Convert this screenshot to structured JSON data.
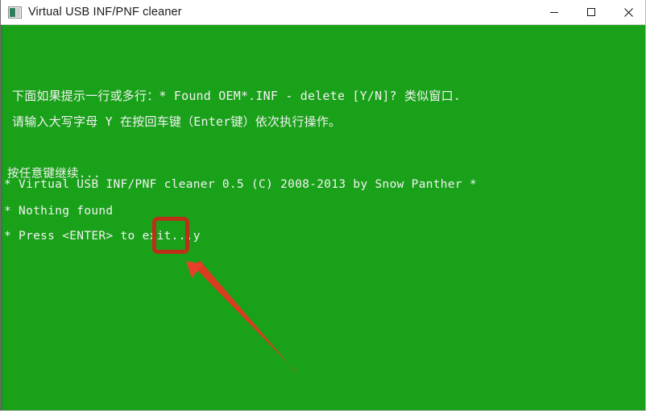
{
  "window": {
    "title": "Virtual USB INF/PNF cleaner",
    "icon": "console-window-icon",
    "controls": {
      "minimize": "minimize-icon",
      "maximize": "maximize-icon",
      "close": "close-icon"
    }
  },
  "console": {
    "background_color": "#1AA11A",
    "text_color": "#f2f2f2",
    "instructions": [
      "下面如果提示一行或多行：* Found OEM*.INF - delete [Y/N]? 类似窗口.",
      "请输入大写字母 Y 在按回车键（Enter键）依次执行操作。"
    ],
    "output_lines": [
      "按任意键继续...",
      "* Virtual USB INF/PNF cleaner 0.5 (C) 2008-2013 by Snow Panther *",
      "* Nothing found",
      "* Press <ENTER> to exit...y"
    ]
  },
  "annotations": {
    "color": "#BD2F17",
    "highlight_box": {
      "name": "highlight-box",
      "target_text": "...y"
    },
    "arrow": {
      "name": "pointer-arrow",
      "points_to": "highlight-box"
    }
  }
}
